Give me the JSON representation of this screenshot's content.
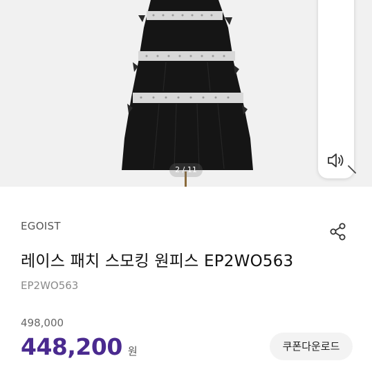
{
  "gallery": {
    "counter": "2 / 11"
  },
  "product": {
    "brand": "EGOIST",
    "title": "레이스 패치 스모킹 원피스 EP2WO563",
    "code": "EP2WO563",
    "original_price": "498,000",
    "sale_price": "448,200",
    "currency": "원"
  },
  "actions": {
    "coupon_label": "쿠폰다운로드"
  },
  "colors": {
    "accent": "#4a2a8f",
    "dress": "#151515",
    "lace": "#d8d8d8"
  },
  "icons": {
    "sound": "speaker-icon",
    "share": "share-icon",
    "magnify": "magnify-icon"
  }
}
